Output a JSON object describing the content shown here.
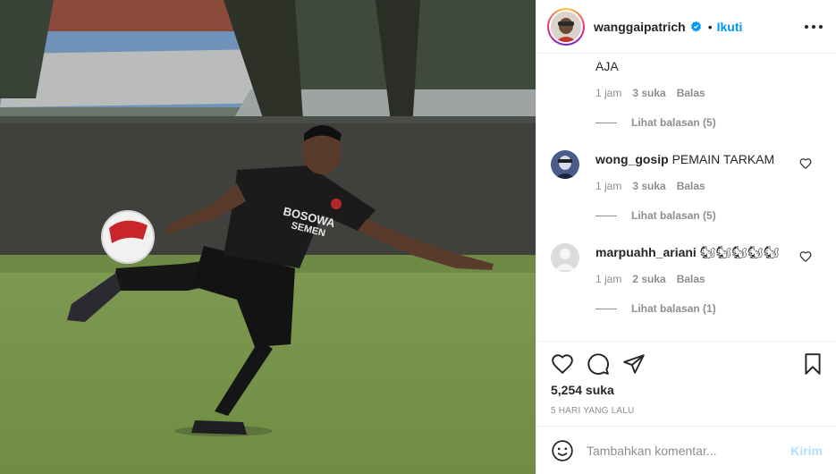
{
  "post": {
    "username": "wanggaipatrich",
    "follow_label": "Ikuti",
    "separator": "•"
  },
  "comments": [
    {
      "text": "AJA",
      "time": "1 jam",
      "likes": "3 suka",
      "reply_label": "Balas",
      "view_replies": "Lihat balasan (5)"
    },
    {
      "username": "wong_gosip",
      "text": "PEMAIN TARKAM",
      "time": "1 jam",
      "likes": "3 suka",
      "reply_label": "Balas",
      "view_replies": "Lihat balasan (5)"
    },
    {
      "username": "marpuahh_ariani",
      "text": "🐿🐿🐿🐿🐿",
      "time": "1 jam",
      "likes": "2 suka",
      "reply_label": "Balas",
      "view_replies": "Lihat balasan (1)"
    }
  ],
  "stats": {
    "likes": "5,254 suka",
    "time_ago": "5 HARI YANG LALU"
  },
  "comment_box": {
    "placeholder": "Tambahkan komentar...",
    "post_label": "Kirim"
  },
  "icons": {
    "verified": "verified-badge-icon",
    "more": "more-options-icon",
    "like": "heart-icon",
    "comment": "comment-bubble-icon",
    "share": "paper-plane-icon",
    "save": "bookmark-icon",
    "emoji": "emoji-smile-icon"
  },
  "colors": {
    "accent": "#0095f6",
    "post_disabled": "#b2dffc",
    "meta": "#8e8e8e"
  }
}
